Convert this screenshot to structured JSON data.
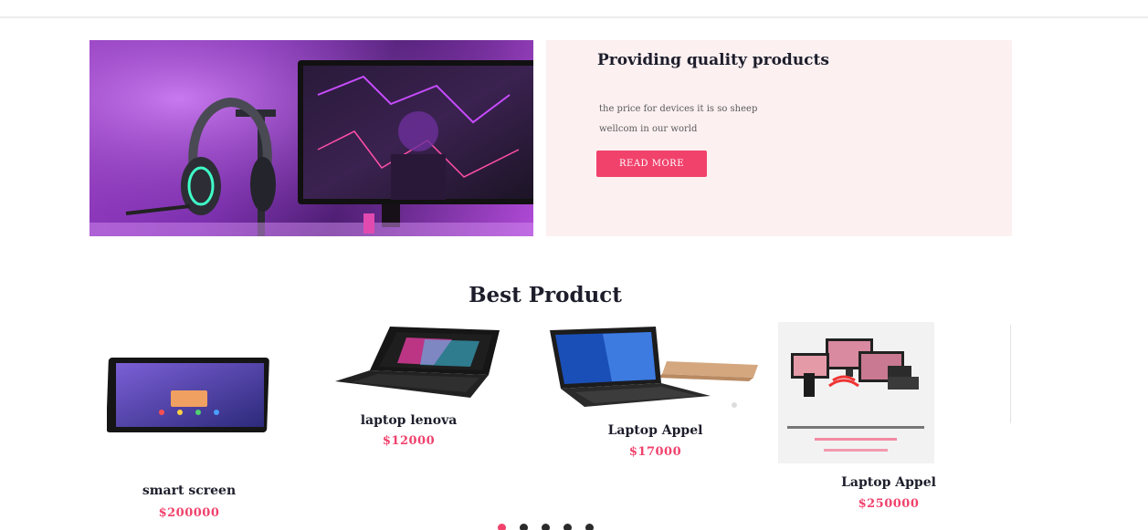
{
  "hero": {
    "title": "Providing quality products",
    "line1": "the price for devices it is so sheep",
    "line2": "wellcom in our world",
    "button_label": "READ MORE"
  },
  "section": {
    "title": "Best Product"
  },
  "products": [
    {
      "name": "smart screen",
      "price": "$200000"
    },
    {
      "name": "laptop lenova",
      "price": "$12000"
    },
    {
      "name": "Laptop Appel",
      "price": "$17000"
    },
    {
      "name": "Laptop Appel",
      "price": "$250000"
    }
  ],
  "carousel": {
    "dots": 5,
    "active": 0
  },
  "colors": {
    "accent": "#f1426c",
    "hero_panel": "#fcf0f1",
    "heading": "#1d1d2b"
  }
}
